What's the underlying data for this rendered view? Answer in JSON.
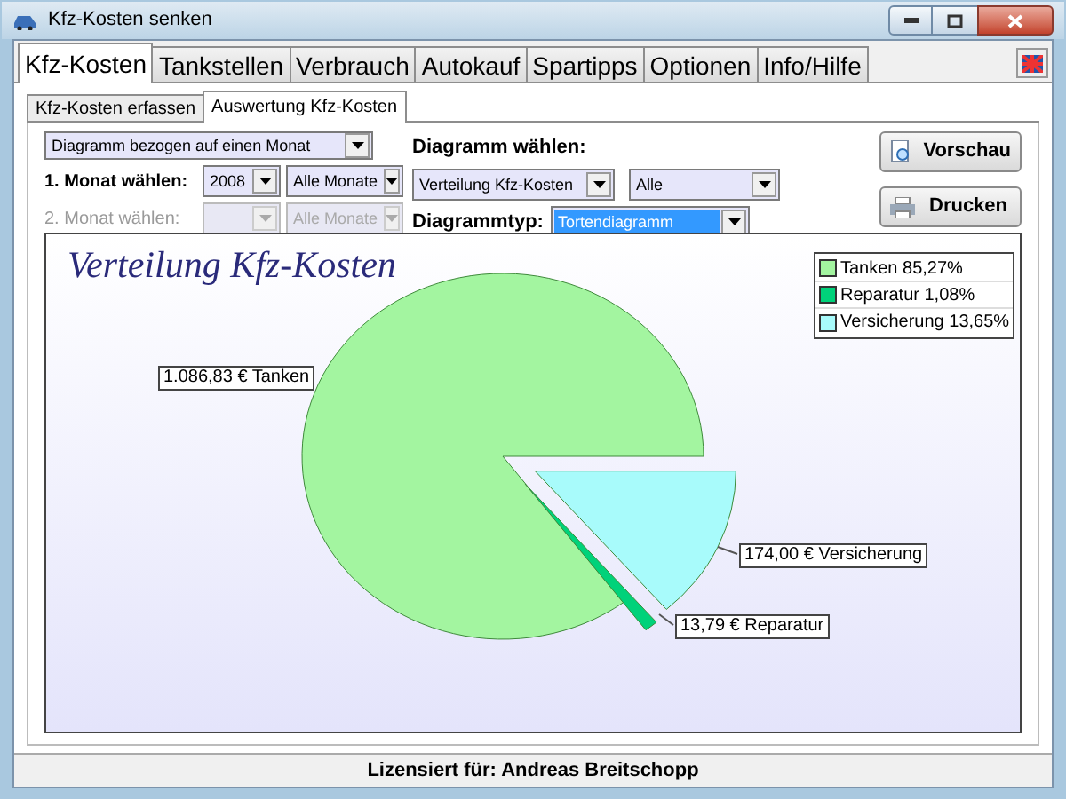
{
  "window": {
    "title": "Kfz-Kosten senken"
  },
  "tabs": [
    {
      "label": "Kfz-Kosten",
      "selected": true
    },
    {
      "label": "Tankstellen",
      "selected": false
    },
    {
      "label": "Verbrauch",
      "selected": false
    },
    {
      "label": "Autokauf",
      "selected": false
    },
    {
      "label": "Spartipps",
      "selected": false
    },
    {
      "label": "Optionen",
      "selected": false
    },
    {
      "label": "Info/Hilfe",
      "selected": false
    }
  ],
  "subtabs": [
    {
      "label": "Kfz-Kosten erfassen",
      "selected": false
    },
    {
      "label": "Auswertung Kfz-Kosten",
      "selected": true
    }
  ],
  "period_select": {
    "value": "Diagramm bezogen auf einen Monat",
    "disabled": false,
    "highlighted": false
  },
  "month_rows": [
    {
      "label": "1. Monat wählen:",
      "disabled": false,
      "year": "2008",
      "month": "Alle Monate"
    },
    {
      "label": "2. Monat wählen:",
      "disabled": true,
      "month": "Alle Monate"
    }
  ],
  "chart_select": {
    "label": "Diagramm wählen:",
    "value": "Verteilung Kfz-Kosten",
    "filter": "Alle"
  },
  "chart_type": {
    "label": "Diagrammtyp:",
    "value": "Tortendiagramm",
    "highlighted": true
  },
  "buttons": [
    {
      "label": "Vorschau",
      "kind": "preview"
    },
    {
      "label": "Drucken",
      "kind": "print"
    }
  ],
  "chart": {
    "chart_data": {
      "type": "pie",
      "title": "Verteilung Kfz-Kosten",
      "categories": [
        "Tanken 85,27%",
        "Reparatur 1,08%",
        "Versicherung 13,65%"
      ],
      "legend": "top-right",
      "series": [
        {
          "values": [
            85.27,
            1.08,
            13.65
          ],
          "colors": [
            "#a3f5a0",
            "#00d27a",
            "#a8fbfb"
          ]
        }
      ],
      "value_labels": [
        "1.086,83 € Tanken",
        "13,79 € Reparatur",
        "174,00 € Versicherung"
      ]
    }
  },
  "status_bar": "Lizensiert für: Andreas Breitschopp"
}
